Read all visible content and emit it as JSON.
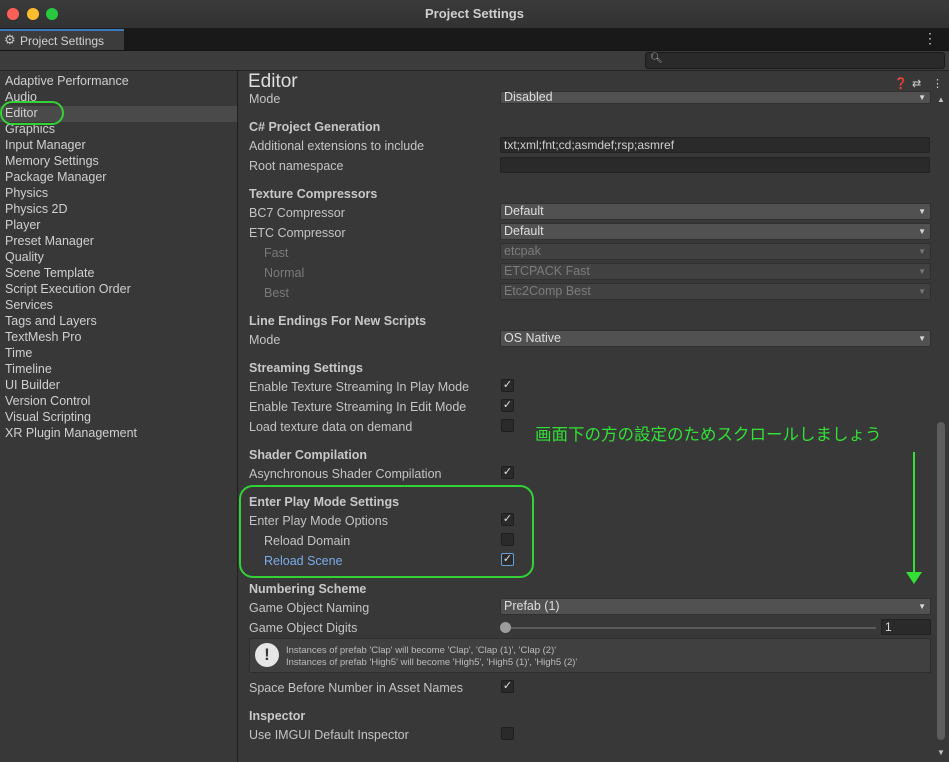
{
  "window": {
    "title": "Project Settings"
  },
  "tab": {
    "label": "Project Settings",
    "icon": "gear-icon"
  },
  "search": {
    "placeholder": ""
  },
  "sidebar": {
    "selected": "Editor",
    "items": [
      "Adaptive Performance",
      "Audio",
      "Editor",
      "Graphics",
      "Input Manager",
      "Memory Settings",
      "Package Manager",
      "Physics",
      "Physics 2D",
      "Player",
      "Preset Manager",
      "Quality",
      "Scene Template",
      "Script Execution Order",
      "Services",
      "Tags and Layers",
      "TextMesh Pro",
      "Time",
      "Timeline",
      "UI Builder",
      "Version Control",
      "Visual Scripting",
      "XR Plugin Management"
    ]
  },
  "editor": {
    "title": "Editor",
    "header_icons": [
      "help-icon",
      "preset-icon",
      "more-icon"
    ],
    "mode_top": {
      "label": "Mode",
      "value": "Disabled"
    },
    "csharp": {
      "header": "C# Project Generation",
      "extensions_label": "Additional extensions to include",
      "extensions_value": "txt;xml;fnt;cd;asmdef;rsp;asmref",
      "namespace_label": "Root namespace",
      "namespace_value": ""
    },
    "texture": {
      "header": "Texture Compressors",
      "bc7_label": "BC7 Compressor",
      "bc7_value": "Default",
      "etc_label": "ETC Compressor",
      "etc_value": "Default",
      "fast_label": "Fast",
      "fast_value": "etcpak",
      "normal_label": "Normal",
      "normal_value": "ETCPACK Fast",
      "best_label": "Best",
      "best_value": "Etc2Comp Best"
    },
    "line_endings": {
      "header": "Line Endings For New Scripts",
      "mode_label": "Mode",
      "mode_value": "OS Native"
    },
    "streaming": {
      "header": "Streaming Settings",
      "play_label": "Enable Texture Streaming In Play Mode",
      "play_checked": true,
      "edit_label": "Enable Texture Streaming In Edit Mode",
      "edit_checked": true,
      "load_label": "Load texture data on demand",
      "load_checked": false
    },
    "shader": {
      "header": "Shader Compilation",
      "async_label": "Asynchronous Shader Compilation",
      "async_checked": true
    },
    "play_mode": {
      "header": "Enter Play Mode Settings",
      "options_label": "Enter Play Mode Options",
      "options_checked": true,
      "domain_label": "Reload Domain",
      "domain_checked": false,
      "scene_label": "Reload Scene",
      "scene_checked": true
    },
    "numbering": {
      "header": "Numbering Scheme",
      "naming_label": "Game Object Naming",
      "naming_value": "Prefab (1)",
      "digits_label": "Game Object Digits",
      "digits_value": "1",
      "help_line1": "Instances of prefab 'Clap' will become 'Clap', 'Clap (1)', 'Clap (2)'",
      "help_line2": "Instances of prefab 'High5' will become 'High5', 'High5 (1)', 'High5 (2)'",
      "space_label": "Space Before Number in Asset Names",
      "space_checked": true
    },
    "inspector": {
      "header": "Inspector",
      "imgui_label": "Use IMGUI Default Inspector",
      "imgui_checked": false
    }
  },
  "annotation": {
    "text": "画面下の方の設定のためスクロールしましょう",
    "color": "#32e036"
  }
}
